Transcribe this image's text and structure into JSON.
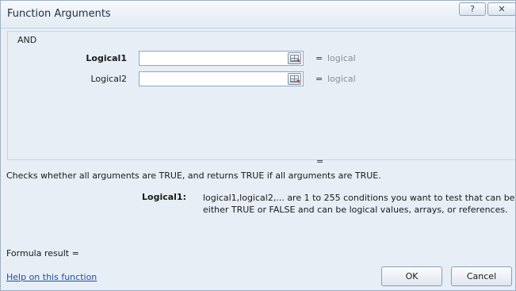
{
  "window": {
    "title": "Function Arguments",
    "help_glyph": "?",
    "close_glyph": "✕"
  },
  "function": {
    "name": "AND"
  },
  "arguments": [
    {
      "label": "Logical1",
      "value": "",
      "result_sep": "=",
      "type": "logical",
      "bold": true,
      "icon": "range-select-icon"
    },
    {
      "label": "Logical2",
      "value": "",
      "result_sep": "=",
      "type": "logical",
      "bold": false,
      "icon": "range-select-icon"
    }
  ],
  "preview_equals": "=",
  "description": "Checks whether all arguments are TRUE, and returns TRUE if all arguments are TRUE.",
  "argument_help": {
    "label": "Logical1:",
    "text": "logical1,logical2,... are 1 to 255 conditions you want to test that can be either TRUE or FALSE and can be logical values, arrays, or references."
  },
  "formula_result": "Formula result =",
  "help_link": "Help on this function",
  "buttons": {
    "ok": "OK",
    "cancel": "Cancel"
  }
}
